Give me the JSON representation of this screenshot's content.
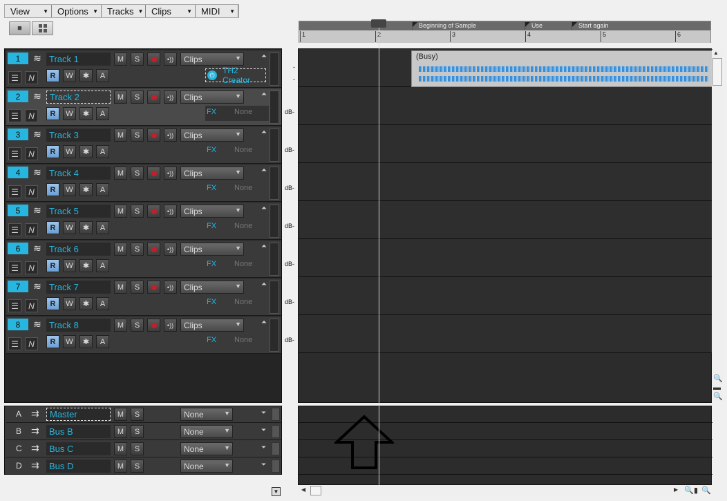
{
  "menu": [
    "View",
    "Options",
    "Tracks",
    "Clips",
    "MIDI"
  ],
  "timeline": {
    "markers": [
      {
        "label": "Beginning of Sample"
      },
      {
        "label": "Use"
      },
      {
        "label": "Start again"
      }
    ],
    "ticks": [
      "1",
      "2",
      "3",
      "4",
      "5",
      "6"
    ]
  },
  "tracks": [
    {
      "num": "1",
      "name": "Track 1",
      "dropdown": "Clips",
      "fx": "TH2 Creator",
      "fx_label": "",
      "fx_value": ""
    },
    {
      "num": "2",
      "name": "Track 2",
      "dropdown": "Clips",
      "fx_label": "FX",
      "fx_value": "None"
    },
    {
      "num": "3",
      "name": "Track 3",
      "dropdown": "Clips",
      "fx_label": "FX",
      "fx_value": "None"
    },
    {
      "num": "4",
      "name": "Track 4",
      "dropdown": "Clips",
      "fx_label": "FX",
      "fx_value": "None"
    },
    {
      "num": "5",
      "name": "Track 5",
      "dropdown": "Clips",
      "fx_label": "FX",
      "fx_value": "None"
    },
    {
      "num": "6",
      "name": "Track 6",
      "dropdown": "Clips",
      "fx_label": "FX",
      "fx_value": "None"
    },
    {
      "num": "7",
      "name": "Track 7",
      "dropdown": "Clips",
      "fx_label": "FX",
      "fx_value": "None"
    },
    {
      "num": "8",
      "name": "Track 8",
      "dropdown": "Clips",
      "fx_label": "FX",
      "fx_value": "None"
    }
  ],
  "buttons": {
    "mute": "M",
    "solo": "S",
    "read": "R",
    "write": "W",
    "asterisk": "✱",
    "auto": "A"
  },
  "db_label": "dB-",
  "clip": {
    "title": "(Busy)"
  },
  "buses": [
    {
      "letter": "A",
      "name": "Master",
      "output": "None"
    },
    {
      "letter": "B",
      "name": "Bus B",
      "output": "None"
    },
    {
      "letter": "C",
      "name": "Bus C",
      "output": "None"
    },
    {
      "letter": "D",
      "name": "Bus D",
      "output": "None"
    }
  ],
  "colors": {
    "accent": "#27b6df",
    "record": "#c0202a",
    "waveform": "#3b8fd6"
  }
}
